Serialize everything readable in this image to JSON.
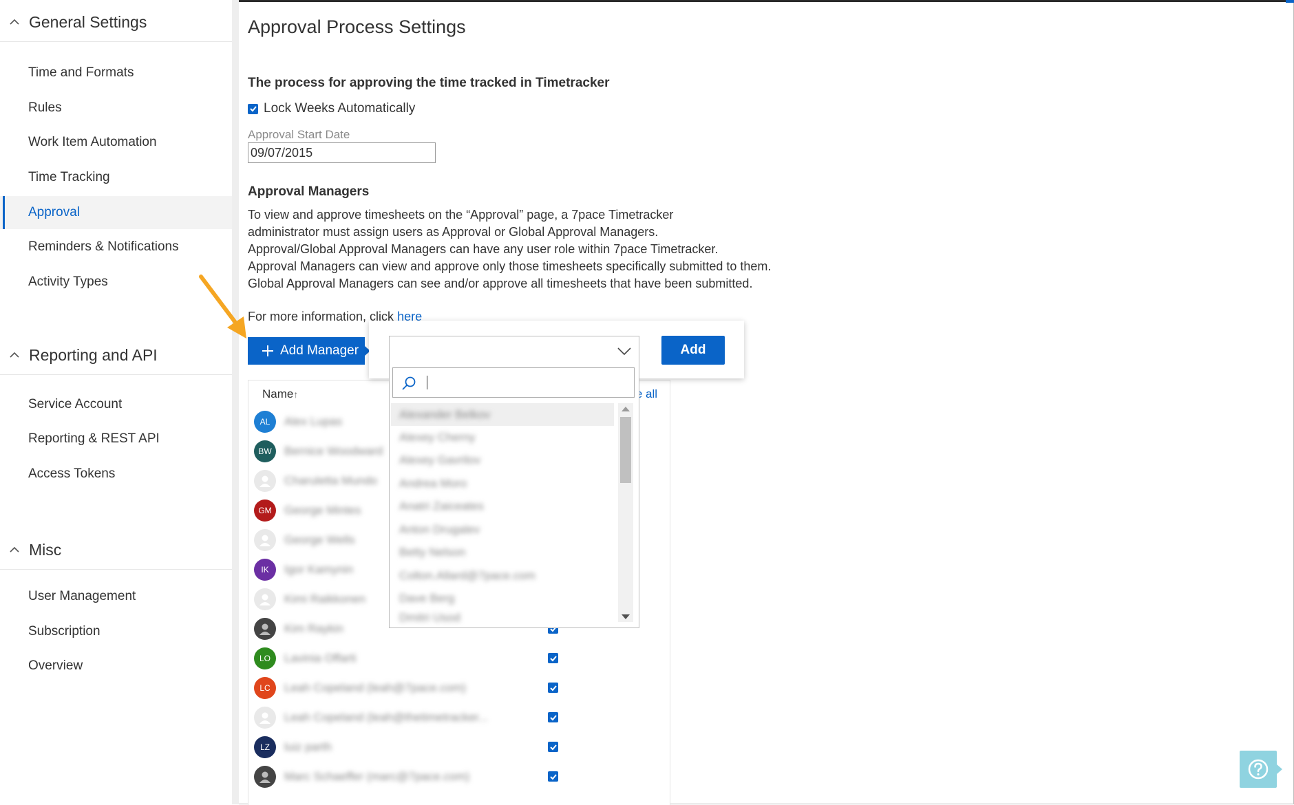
{
  "sidebar": {
    "sections": [
      {
        "title": "General Settings",
        "items": [
          "Time and Formats",
          "Rules",
          "Work Item Automation",
          "Time Tracking",
          "Approval",
          "Reminders & Notifications",
          "Activity Types"
        ]
      },
      {
        "title": "Reporting and API",
        "items": [
          "Service Account",
          "Reporting & REST API",
          "Access Tokens"
        ]
      },
      {
        "title": "Misc",
        "items": [
          "User Management",
          "Subscription",
          "Overview"
        ]
      }
    ],
    "active_item": "Approval"
  },
  "main": {
    "title": "Approval Process Settings",
    "process_title": "The process for approving the time tracked in Timetracker",
    "lock_weeks_label": "Lock Weeks Automatically",
    "approval_start_label": "Approval Start Date",
    "approval_start_value": "09/07/2015",
    "managers_title": "Approval Managers",
    "description_lines": [
      "To view and approve timesheets on the “Approval” page, a 7pace Timetracker",
      "administrator must assign users as Approval or Global Approval Managers.",
      "Approval/Global Approval Managers can have any user role within 7pace Timetracker.",
      "Approval Managers can view and approve only those timesheets specifically submitted to them.",
      "Global Approval Managers can see and/or approve all timesheets that have been submitted."
    ],
    "more_info_prefix": "For more information, click",
    "more_info_link": "here",
    "add_manager_label": "Add Manager"
  },
  "table": {
    "name_header": "Name",
    "sort_glyph": "↑",
    "all_header": "e all",
    "rows": [
      {
        "initials": "AL",
        "color": "#1e7fd4",
        "name": "Alex Lupas",
        "checked": false
      },
      {
        "initials": "BW",
        "color": "#1f5e5e",
        "name": "Bernice Woodward",
        "checked": false
      },
      {
        "initials": "",
        "color": "",
        "name": "Charuletta Mundo",
        "checked": false
      },
      {
        "initials": "GM",
        "color": "#b31b1b",
        "name": "George Mintes",
        "checked": false
      },
      {
        "initials": "",
        "color": "",
        "name": "George Wells",
        "checked": false
      },
      {
        "initials": "IK",
        "color": "#6b2fa3",
        "name": "Igor Kamynin",
        "checked": false
      },
      {
        "initials": "",
        "color": "",
        "name": "Kimi Raikkonen",
        "checked": false
      },
      {
        "initials": "",
        "color": "photo",
        "name": "Kim Raykin",
        "checked": true
      },
      {
        "initials": "LO",
        "color": "#2e8b1e",
        "name": "Lavinia Offarti",
        "checked": true
      },
      {
        "initials": "LC",
        "color": "#e0461c",
        "name": "Leah Copeland (leah@7pace.com)",
        "checked": true
      },
      {
        "initials": "",
        "color": "",
        "name": "Leah Copeland (leah@thetimetracker...",
        "checked": true
      },
      {
        "initials": "LZ",
        "color": "#1a2d5e",
        "name": "luiz parth",
        "checked": true
      },
      {
        "initials": "",
        "color": "photo",
        "name": "Marc Schaeffer (marc@7pace.com)",
        "checked": true
      }
    ]
  },
  "dropdown": {
    "selected": "",
    "search_value": "",
    "add_label": "Add",
    "options": [
      "Alexander Belkov",
      "Alexey Cherny",
      "Alexey Gavrilov",
      "Andrea Moro",
      "Anatri Zaiceates",
      "Anton Drugalev",
      "Betty Nelson",
      "Colton.Allard@7pace.com",
      "Dave Berg",
      "Dmitri Usod"
    ]
  },
  "icons": {
    "collapse": "chevron-up-icon",
    "plus": "plus-icon",
    "select": "chevron-down-icon",
    "search": "search-icon",
    "help": "help-icon",
    "pointer": "arrow-annotation-icon"
  },
  "colors": {
    "accent": "#0a64c8",
    "help": "#8fd3e0",
    "annotation": "#f5a623"
  }
}
